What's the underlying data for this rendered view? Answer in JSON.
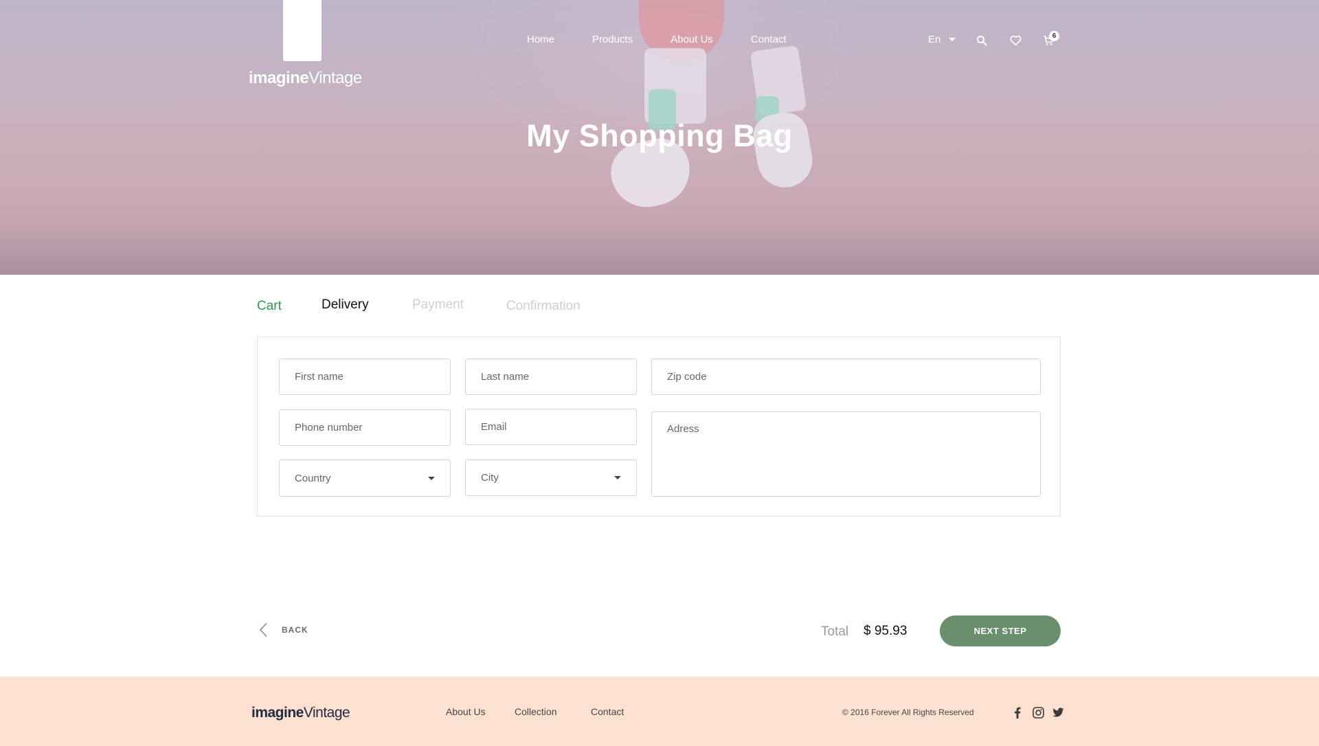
{
  "brand": {
    "logo_bold": "imagine",
    "logo_thin": "Vintage"
  },
  "nav": {
    "home": "Home",
    "products": "Products",
    "about": "About Us",
    "contact": "Contact"
  },
  "header": {
    "language": "En",
    "cart_count": "6"
  },
  "hero": {
    "title": "My Shopping Bag"
  },
  "steps": {
    "cart": "Cart",
    "delivery": "Delivery",
    "payment": "Payment",
    "confirmation": "Confirmation"
  },
  "form": {
    "first_name_placeholder": "First name",
    "last_name_placeholder": "Last name",
    "zip_placeholder": "Zip code",
    "phone_placeholder": "Phone number",
    "email_placeholder": "Email",
    "address_placeholder": "Adress",
    "country_value": "Country",
    "city_value": "City"
  },
  "actions": {
    "back_label": "BACK",
    "total_label": "Total",
    "total_value": "$ 95.93",
    "next_label": "NEXT STEP"
  },
  "footer": {
    "logo_bold": "imagine",
    "logo_thin": "Vintage",
    "links": {
      "about": "About Us",
      "collection": "Collection",
      "contact": "Contact"
    },
    "copyright": "© 2016 Forever All Rights Reserved"
  },
  "colors": {
    "accent_green": "#2d9a4c",
    "button_green": "#6a8f6d",
    "footer_bg": "#fde1d0",
    "hero_tint": "#c9b1bd"
  },
  "icons": [
    "search-icon",
    "heart-icon",
    "cart-icon",
    "chevron-left-icon",
    "facebook-icon",
    "instagram-icon",
    "twitter-icon"
  ]
}
